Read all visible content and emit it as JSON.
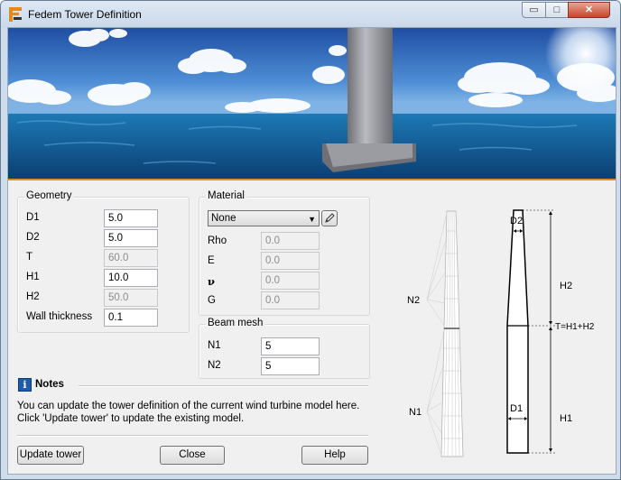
{
  "window": {
    "title": "Fedem Tower Definition",
    "controls": {
      "minimize": "▭",
      "maximize": "□",
      "close": "✕"
    }
  },
  "geometry": {
    "title": "Geometry",
    "rows": [
      {
        "label": "D1",
        "value": "5.0",
        "readonly": false
      },
      {
        "label": "D2",
        "value": "5.0",
        "readonly": false
      },
      {
        "label": "T",
        "value": "60.0",
        "readonly": true
      },
      {
        "label": "H1",
        "value": "10.0",
        "readonly": false
      },
      {
        "label": "H2",
        "value": "50.0",
        "readonly": true
      },
      {
        "label": "Wall thickness",
        "value": "0.1",
        "readonly": false
      }
    ]
  },
  "material": {
    "title": "Material",
    "selected": "None",
    "rows": [
      {
        "label": "Rho",
        "value": "0.0"
      },
      {
        "label": "E",
        "value": "0.0"
      },
      {
        "label": "ν",
        "value": "0.0"
      },
      {
        "label": "G",
        "value": "0.0"
      }
    ]
  },
  "beam_mesh": {
    "title": "Beam mesh",
    "rows": [
      {
        "label": "N1",
        "value": "5"
      },
      {
        "label": "N2",
        "value": "5"
      }
    ]
  },
  "notes": {
    "icon_letter": "i",
    "title": "Notes",
    "line1": "You can update the tower definition of the current wind turbine model here.",
    "line2": "Click 'Update tower' to update the existing model."
  },
  "buttons": {
    "update": "Update tower",
    "close": "Close",
    "help": "Help"
  },
  "diagram": {
    "mesh_top_label": "N2",
    "mesh_bottom_label": "N1",
    "d2": "D2",
    "d1": "D1",
    "h2": "H2",
    "h1": "H1",
    "t_label": "T=H1+H2"
  },
  "colors": {
    "accent_line": "#e58a1f",
    "notes_icon": "#1e5ca8"
  }
}
